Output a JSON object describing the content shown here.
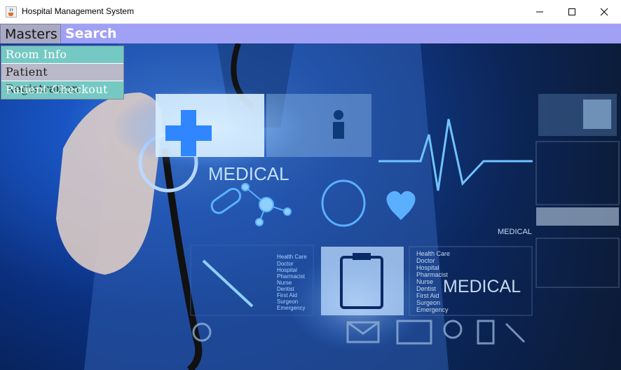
{
  "window": {
    "title": "Hospital Management System",
    "icon": "java-cup-icon",
    "controls": {
      "minimize": "minimize-icon",
      "maximize": "maximize-icon",
      "close": "close-icon"
    }
  },
  "menubar": {
    "items": [
      {
        "label": "Masters",
        "state": "open"
      },
      {
        "label": "Search"
      }
    ]
  },
  "dropdown": {
    "items": [
      {
        "label": "Room Info"
      },
      {
        "label": "Patient Registration"
      },
      {
        "label": "Patient Checkout"
      }
    ]
  },
  "background": {
    "labels": {
      "medical_top": "MEDICAL",
      "medical_right": "MEDICAL",
      "medical_bottom": "MEDICAL",
      "list_left": [
        "Health Care",
        "Doctor",
        "Hospital",
        "Pharmacist",
        "Nurse",
        "Dentist",
        "First Aid",
        "Surgeon",
        "Emergency"
      ],
      "list_right": [
        "Health Care",
        "Doctor",
        "Hospital",
        "Pharmacist",
        "Nurse",
        "Dentist",
        "First Aid",
        "Surgeon",
        "Emergency"
      ]
    }
  },
  "colors": {
    "menubar": "#a0a0f4",
    "masters_active": "#a9a9c2",
    "dropdown_teal": "#75c9c4",
    "dropdown_grey": "#b9b9c9"
  }
}
